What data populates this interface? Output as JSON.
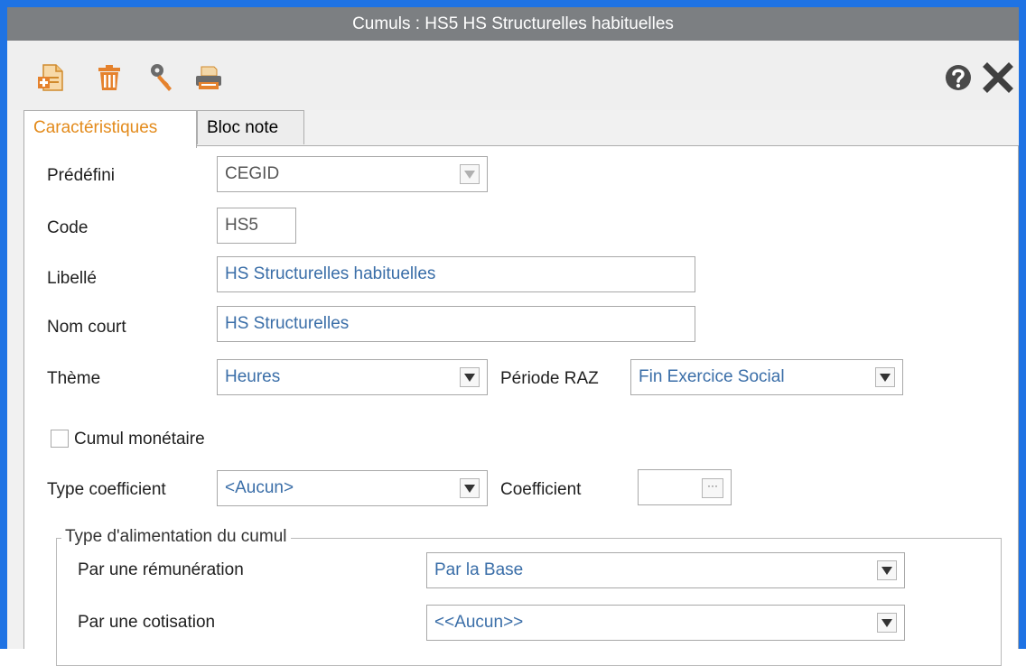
{
  "window": {
    "title": "Cumuls  : HS5 HS Structurelles habituelles"
  },
  "toolbar": {
    "icons": [
      "new-document-icon",
      "trash-icon",
      "key-icon",
      "printer-icon"
    ],
    "right_icons": [
      "help-icon",
      "close-icon"
    ]
  },
  "tabs": [
    {
      "label": "Caractéristiques",
      "active": true
    },
    {
      "label": "Bloc note",
      "active": false
    }
  ],
  "form": {
    "predefini": {
      "label": "Prédéfini",
      "value": "CEGID"
    },
    "code": {
      "label": "Code",
      "value": "HS5"
    },
    "libelle": {
      "label": "Libellé",
      "value": "HS Structurelles habituelles"
    },
    "nom_court": {
      "label": "Nom court",
      "value": "HS Structurelles"
    },
    "theme": {
      "label": "Thème",
      "value": "Heures"
    },
    "periode_raz": {
      "label": "Période RAZ",
      "value": "Fin Exercice Social"
    },
    "cumul_monetaire": {
      "label": "Cumul monétaire",
      "checked": false
    },
    "type_coefficient": {
      "label": "Type coefficient",
      "value": "<Aucun>"
    },
    "coefficient": {
      "label": "Coefficient",
      "value": ""
    },
    "alimentation": {
      "title": "Type d'alimentation du cumul",
      "remuneration": {
        "label": "Par une rémunération",
        "value": "Par la Base"
      },
      "cotisation": {
        "label": "Par une cotisation",
        "value": "<<Aucun>>"
      }
    }
  },
  "colors": {
    "titlebar": "#7c7f82",
    "frame": "#1f73e4",
    "active_tab": "#e38b1c",
    "field_text": "#3a6ea8"
  }
}
